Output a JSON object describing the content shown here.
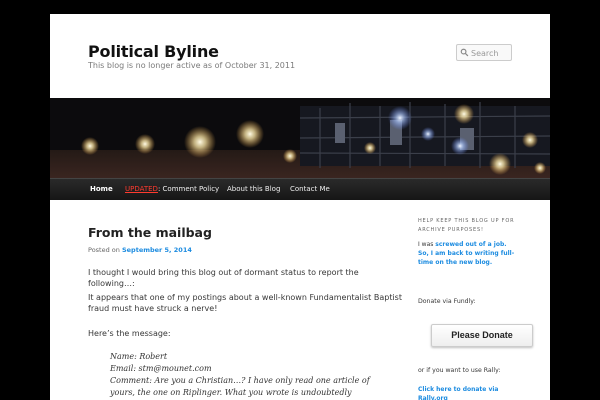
{
  "site": {
    "title": "Political Byline",
    "description": "This blog is no longer active as of October 31, 2011"
  },
  "search": {
    "placeholder": "Search"
  },
  "nav": {
    "home": "Home",
    "updated": "UPDATED",
    "comment_policy": ": Comment Policy",
    "about": "About this Blog",
    "contact": "Contact Me"
  },
  "post": {
    "title": "From the mailbag",
    "posted_on_label": "Posted on",
    "date": "September 5, 2014",
    "para1": "I thought I would bring this blog out of dormant status to report the following…:",
    "para2_line1": "It appears that one of my postings about a well-known Fundamentalist Baptist",
    "para2_line2": "fraud must have struck a nerve!",
    "para3": "Here’s the message:",
    "quote_name": "Name: Robert",
    "quote_email": "Email: stm@mounet.com",
    "quote_comment1": "Comment: Are you a Christian…? I have only read one article of",
    "quote_comment2": "yours, the one on Riplinger. What you wrote is undoubtedly"
  },
  "sidebar": {
    "heading": "Help keep this blog up for archive purposes!",
    "text_prefix": "I was ",
    "text_link": "screwed out of a job. So, I am back to writing full-time on the new blog.",
    "donate_label": "Donate via Fundly:",
    "donate_button": "Please Donate",
    "rally_label": "or if you want to use Rally:",
    "rally_link": "Click here to donate via Rally.org"
  },
  "colors": {
    "link": "#1b8be0",
    "updated": "#ff3b2f",
    "nav_bg": "#1f1f1f"
  }
}
